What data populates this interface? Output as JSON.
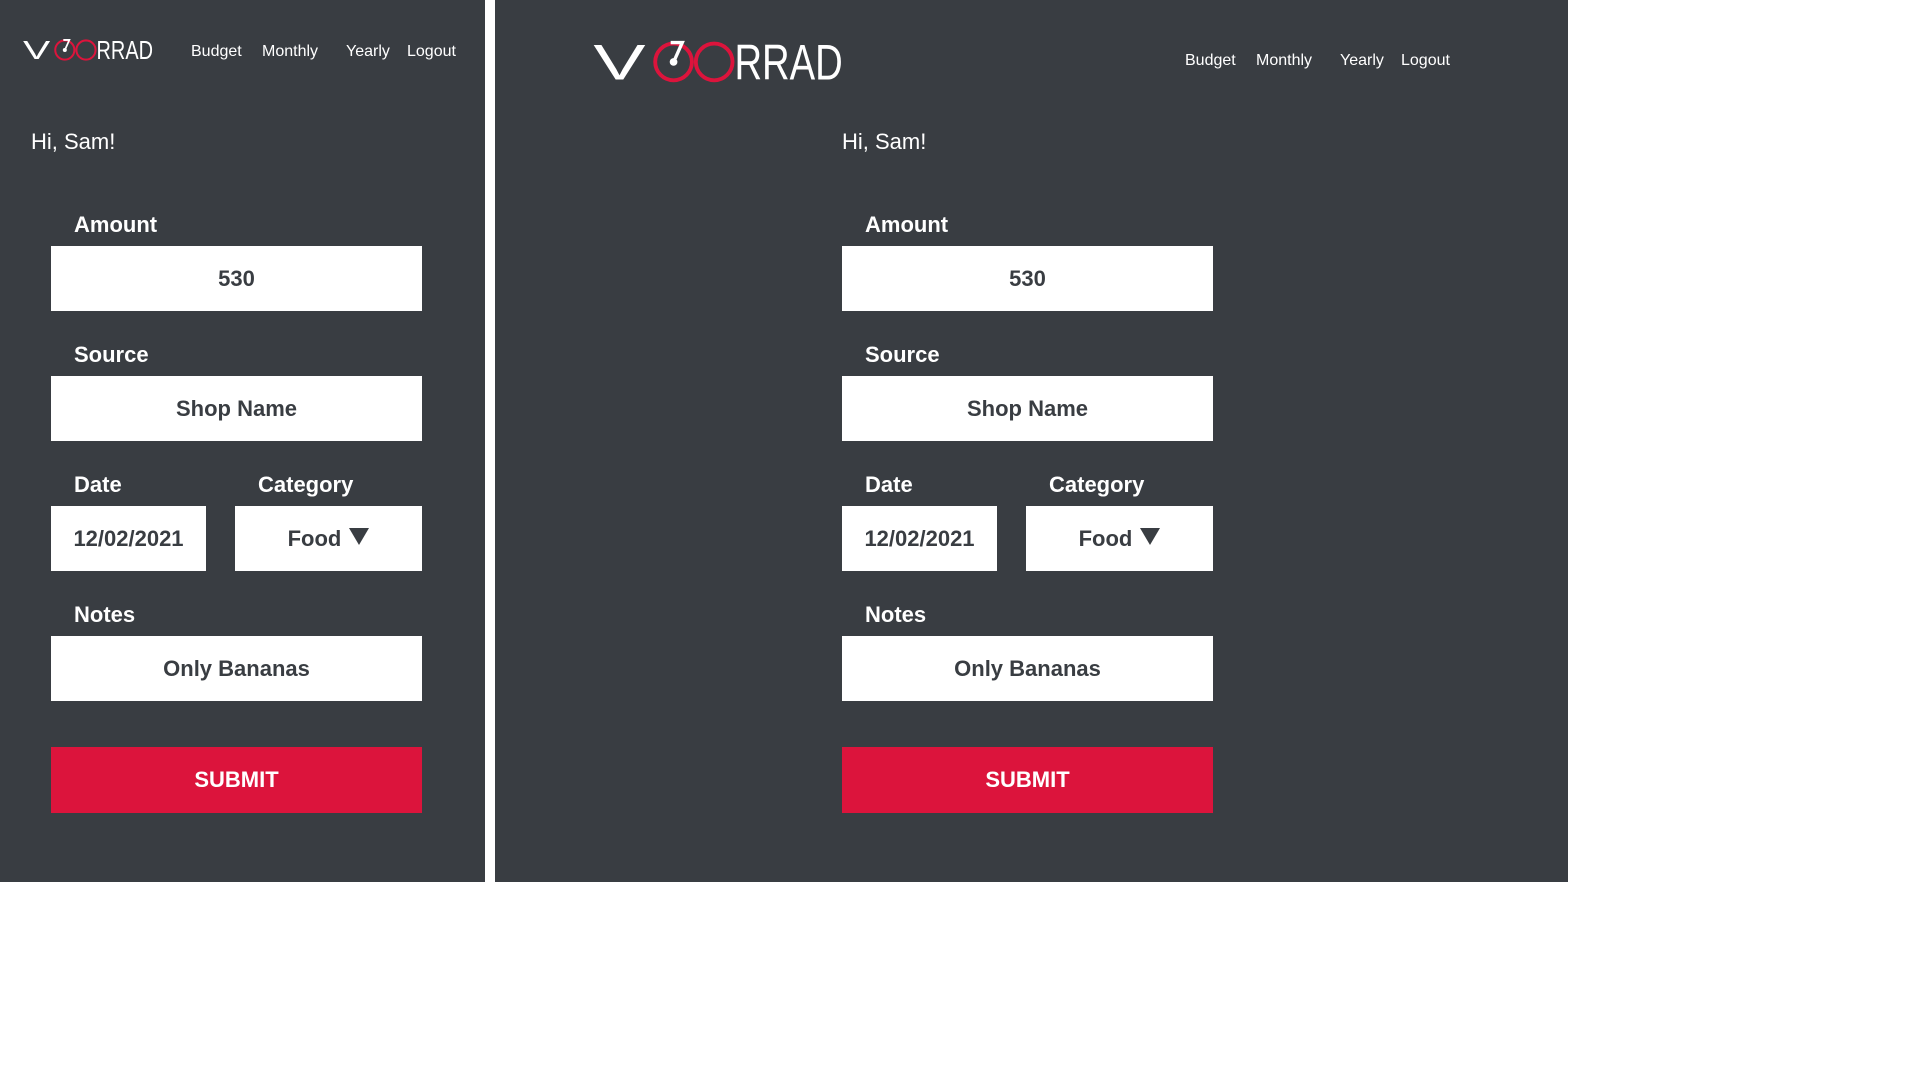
{
  "brand": {
    "name": "VOORRAD",
    "colors": {
      "background": "#393d42",
      "accent": "#dc143c",
      "text": "#ffffff",
      "field_bg": "#ffffff"
    }
  },
  "nav": {
    "items": [
      {
        "label": "Budget"
      },
      {
        "label": "Monthly"
      },
      {
        "label": "Yearly"
      },
      {
        "label": "Logout"
      }
    ]
  },
  "greeting": "Hi, Sam!",
  "form": {
    "amount_label": "Amount",
    "amount_value": "530",
    "source_label": "Source",
    "source_value": "Shop Name",
    "date_label": "Date",
    "date_value": "12/02/2021",
    "category_label": "Category",
    "category_value": "Food",
    "category_icon": "caret-down-icon",
    "notes_label": "Notes",
    "notes_value": "Only Bananas",
    "submit_label": "SUBMIT"
  }
}
